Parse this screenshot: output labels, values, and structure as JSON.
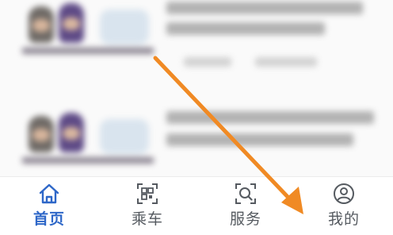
{
  "colors": {
    "accent": "#2e67c8",
    "tab_inactive": "#555a60",
    "annotation_arrow": "#f08a24"
  },
  "tabs": [
    {
      "label": "首页",
      "icon": "home-icon",
      "active": true
    },
    {
      "label": "乘车",
      "icon": "qr-code-icon",
      "active": false
    },
    {
      "label": "服务",
      "icon": "search-service-icon",
      "active": false
    },
    {
      "label": "我的",
      "icon": "user-profile-icon",
      "active": false
    }
  ]
}
